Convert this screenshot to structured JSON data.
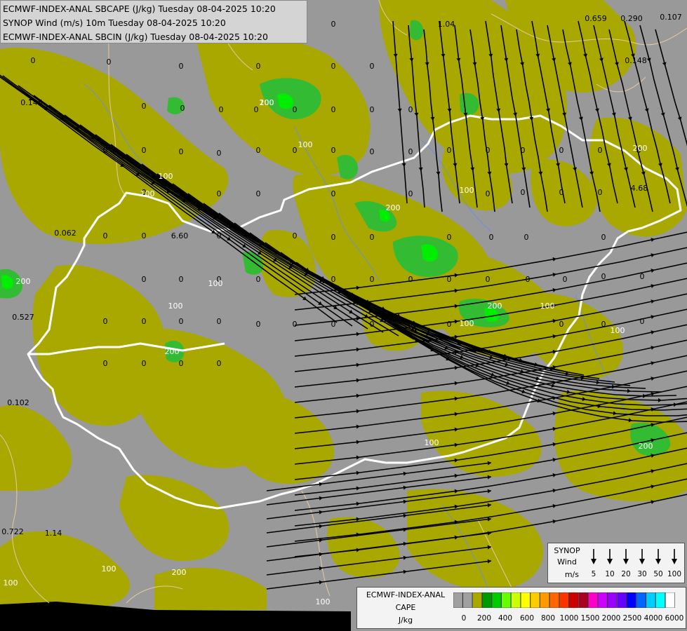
{
  "header": {
    "line1": "ECMWF-INDEX-ANAL SBCAPE (J/kg) Tuesday 08-04-2025 10:20",
    "line2": "SYNOP Wind (m/s) 10m Tuesday 08-04-2025 10:20",
    "line3": "ECMWF-INDEX-ANAL SBCIN (J/kg) Tuesday 08-04-2025 10:20"
  },
  "wind_legend": {
    "title1": "SYNOP",
    "title2": "Wind",
    "unit": "m/s",
    "speeds": [
      "5",
      "10",
      "20",
      "30",
      "50",
      "100"
    ]
  },
  "cape_legend": {
    "name1": "ECMWF-INDEX-ANAL",
    "name2": "CAPE",
    "unit": "J/kg",
    "ticks": [
      "0",
      "200",
      "400",
      "600",
      "800",
      "1000",
      "1500",
      "2000",
      "2500",
      "4000",
      "6000"
    ],
    "colors": [
      "#a0a0a0",
      "#a0a0a0",
      "#a8a800",
      "#009900",
      "#00cc00",
      "#66ff00",
      "#ccff00",
      "#ffff00",
      "#ffcc00",
      "#ff9900",
      "#ff6600",
      "#ff3300",
      "#cc0000",
      "#aa0022",
      "#ff00cc",
      "#cc00ff",
      "#9900ff",
      "#6600ff",
      "#0000ff",
      "#0066ff",
      "#00ccff",
      "#00ffff",
      "#ffffff"
    ]
  },
  "colors": {
    "background": "#999999",
    "cape_low": "#a8a800",
    "cape_mid": "#33bb33",
    "cape_high": "#00ee00",
    "border": "#ffffff",
    "region": "#e8c9a0",
    "river": "#6f8fd8"
  },
  "cin_labels": [
    {
      "text": "0"
    },
    {
      "text": "0"
    },
    {
      "text": "0"
    },
    {
      "text": "0"
    },
    {
      "text": "0"
    },
    {
      "text": "0"
    },
    {
      "text": "0"
    },
    {
      "text": "0"
    },
    {
      "text": "0"
    },
    {
      "text": "0"
    },
    {
      "text": "0"
    },
    {
      "text": "0"
    },
    {
      "text": "0"
    },
    {
      "text": "0"
    },
    {
      "text": "0"
    },
    {
      "text": "0"
    },
    {
      "text": "0"
    },
    {
      "text": "0"
    },
    {
      "text": "0"
    },
    {
      "text": "0"
    },
    {
      "text": "0"
    },
    {
      "text": "0"
    },
    {
      "text": "0"
    },
    {
      "text": "0"
    },
    {
      "text": "0"
    },
    {
      "text": "0"
    },
    {
      "text": "0"
    },
    {
      "text": "0"
    },
    {
      "text": "0"
    },
    {
      "text": "0"
    },
    {
      "text": "0"
    },
    {
      "text": "0"
    },
    {
      "text": "0"
    },
    {
      "text": "0"
    },
    {
      "text": "0"
    },
    {
      "text": "0"
    },
    {
      "text": "0"
    },
    {
      "text": "0"
    },
    {
      "text": "0"
    },
    {
      "text": "0"
    },
    {
      "text": "0"
    },
    {
      "text": "0"
    },
    {
      "text": "0"
    },
    {
      "text": "0"
    },
    {
      "text": "0"
    },
    {
      "text": "0"
    },
    {
      "text": "0"
    },
    {
      "text": "0"
    },
    {
      "text": "0"
    },
    {
      "text": "0"
    },
    {
      "text": "0"
    },
    {
      "text": "0"
    },
    {
      "text": "0"
    },
    {
      "text": "0"
    },
    {
      "text": "0"
    },
    {
      "text": "0"
    },
    {
      "text": "0"
    },
    {
      "text": "0"
    },
    {
      "text": "0"
    },
    {
      "text": "0"
    },
    {
      "text": "0"
    },
    {
      "text": "0"
    },
    {
      "text": "0"
    },
    {
      "text": "0"
    },
    {
      "text": "0"
    },
    {
      "text": "0"
    },
    {
      "text": "0"
    },
    {
      "text": "0"
    },
    {
      "text": "0"
    },
    {
      "text": "0"
    },
    {
      "text": "0"
    },
    {
      "text": "0"
    },
    {
      "text": "0"
    },
    {
      "text": "0"
    },
    {
      "text": "0"
    },
    {
      "text": "0"
    },
    {
      "text": "0"
    },
    {
      "text": "0"
    },
    {
      "text": "0"
    },
    {
      "text": "0"
    },
    {
      "text": "1.04"
    },
    {
      "text": "0.659"
    },
    {
      "text": "0.290"
    },
    {
      "text": "0.107"
    },
    {
      "text": "0.148"
    },
    {
      "text": "0.145"
    },
    {
      "text": "4.68"
    },
    {
      "text": "6.60"
    },
    {
      "text": "0.062"
    },
    {
      "text": "0.527"
    },
    {
      "text": "0.102"
    },
    {
      "text": "0.722"
    },
    {
      "text": "1.14"
    }
  ],
  "contour_labels": [
    {
      "text": "100"
    },
    {
      "text": "100"
    },
    {
      "text": "100"
    },
    {
      "text": "100"
    },
    {
      "text": "100"
    },
    {
      "text": "100"
    },
    {
      "text": "100"
    },
    {
      "text": "100"
    },
    {
      "text": "100"
    },
    {
      "text": "100"
    },
    {
      "text": "100"
    },
    {
      "text": "100"
    },
    {
      "text": "100"
    },
    {
      "text": "100"
    },
    {
      "text": "200"
    },
    {
      "text": "200"
    },
    {
      "text": "200"
    },
    {
      "text": "200"
    },
    {
      "text": "200"
    },
    {
      "text": "200"
    },
    {
      "text": "200"
    },
    {
      "text": "200"
    }
  ]
}
